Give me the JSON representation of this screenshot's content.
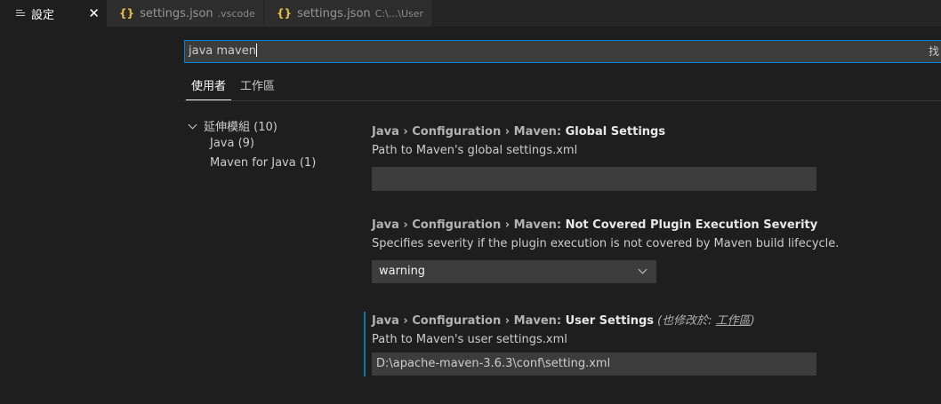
{
  "tabs": [
    {
      "title": "設定",
      "description": "",
      "active": true,
      "icon": "menu-icon"
    },
    {
      "title": "settings.json",
      "description": ".vscode",
      "active": false,
      "icon": "braces-icon"
    },
    {
      "title": "settings.json",
      "description": "C:\\...\\User",
      "active": false,
      "icon": "braces-icon"
    }
  ],
  "tab_icon_glyph": "{}",
  "close_glyph": "✕",
  "search": {
    "value": "java maven",
    "trailing_text": "找"
  },
  "scopes": [
    {
      "label": "使用者",
      "active": true
    },
    {
      "label": "工作區",
      "active": false
    }
  ],
  "toc": {
    "group": "延伸模組 (10)",
    "items": [
      "Java (9)",
      "Maven for Java (1)"
    ]
  },
  "settings": [
    {
      "category": "Java › Configuration › Maven: ",
      "label": "Global Settings",
      "description": "Path to Maven's global settings.xml",
      "control": "text",
      "value": ""
    },
    {
      "category": "Java › Configuration › Maven: ",
      "label": "Not Covered Plugin Execution Severity",
      "description": "Specifies severity if the plugin execution is not covered by Maven build lifecycle.",
      "control": "select",
      "value": "warning"
    },
    {
      "category": "Java › Configuration › Maven: ",
      "label": "User Settings",
      "modified_prefix": "(也修改於: ",
      "modified_link": "工作區",
      "modified_suffix": ")",
      "description": "Path to Maven's user settings.xml",
      "control": "text",
      "value": "D:\\apache-maven-3.6.3\\conf\\setting.xml"
    }
  ],
  "colors": {
    "accent": "#007fd4",
    "modified_indicator": "#0c7d9d",
    "icon_braces": "#e8c441"
  }
}
